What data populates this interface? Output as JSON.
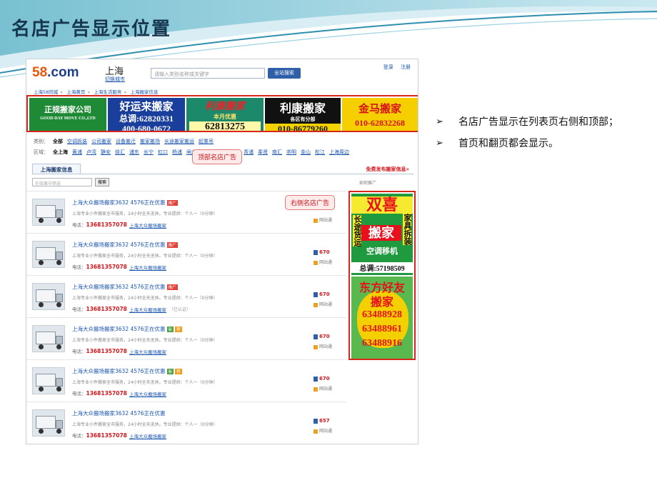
{
  "slide": {
    "title": "名店广告显示位置",
    "bullets": [
      "名店广告显示在列表页右侧和顶部；",
      "首页和翻页都会显示。"
    ]
  },
  "header": {
    "logo_prefix": "58",
    "logo_suffix": ".com",
    "city": "上海",
    "city_switch": "切换城市",
    "search_placeholder": "请输入类别名称或关键字",
    "search_button": "全站搜索",
    "login": "登录",
    "register": "注册"
  },
  "breadcrumb": [
    "上海58同城",
    "上海黄页",
    "上海生活服务",
    "上海搬家信息"
  ],
  "top_ads": [
    {
      "line1": "正规搬家公司",
      "line2": "GOOD DAY MOVE CO.,LTD"
    },
    {
      "line1": "好运来搬家",
      "line2": "总调:62820331",
      "line3": "400-680-0672"
    },
    {
      "line1": "利康搬家",
      "line2": "本月优惠",
      "line3": "62813275"
    },
    {
      "line1": "利康搬家",
      "line2": "各区有分部",
      "line3": "010-86779260"
    },
    {
      "line1": "金马搬家",
      "line2": "010-62832268"
    }
  ],
  "filters": {
    "category_label": "类别：",
    "category_selected": "全部",
    "category_items": [
      "空调拆装",
      "公司搬家",
      "设备搬迁",
      "搬家搬场",
      "长途搬家搬运",
      "起重吊"
    ],
    "district_label": "区域：",
    "district_selected": "全上海",
    "district_items": [
      "黄浦",
      "卢湾",
      "静安",
      "徐汇",
      "浦东",
      "长宁",
      "虹口",
      "杨浦",
      "闸北",
      "普陀",
      "宝山",
      "嘉定",
      "青浦",
      "奉贤",
      "南汇",
      "崇明",
      "金山",
      "松江",
      "上海周边"
    ]
  },
  "list_tab": "上海搬家信息",
  "free_post": "免费发布搬家信息»",
  "filter_placeholder": "在结果中筛选",
  "search_small": "搜索",
  "sort_label": "如何推广",
  "callouts": {
    "top": "顶部名店广告",
    "right": "右侧名店广告"
  },
  "listings": [
    {
      "title": "上海大众搬场搬家3632 4576正在优惠",
      "badges": [
        "推广"
      ],
      "desc": "上海专业小件搬家全市服务，24小时全天无休。专业提供：个人一（0分钟）",
      "phone_label": "电话：",
      "phone": "13681357078",
      "company": "上海大众搬场搬家",
      "tag": "",
      "price": "",
      "verify": "网站通"
    },
    {
      "title": "上海大众搬场搬家3632 4576正在优惠",
      "badges": [
        "推广"
      ],
      "desc": "上海专业小件搬家全市服务，24小时全天无休。专业提供：个人一（0分钟）",
      "phone_label": "电话：",
      "phone": "13681357078",
      "company": "上海大众搬场搬家",
      "tag": "",
      "price": "670",
      "verify": "网站通"
    },
    {
      "title": "上海大众搬场搬家3632 4576正在优惠",
      "badges": [
        "推广"
      ],
      "desc": "上海专业小件搬家全市服务，24小时全天无休。专业提供：个人一（0分钟）",
      "phone_label": "电话：",
      "phone": "13681357078",
      "company": "上海大众搬场搬家",
      "tag": "（已认证）",
      "price": "670",
      "verify": "网站通"
    },
    {
      "title": "上海大众搬场搬家3632 4576正在优惠",
      "badges": [
        "新",
        "荐"
      ],
      "desc": "上海专业小件搬家全市服务，24小时全天无休。专业提供：个人一（0分钟）",
      "phone_label": "电话：",
      "phone": "13681357078",
      "company": "上海大众搬场搬家",
      "tag": "",
      "price": "670",
      "verify": "网站通"
    },
    {
      "title": "上海大众搬场搬家3632 4576正在优惠",
      "badges": [
        "新",
        "荐"
      ],
      "desc": "上海专业小件搬家全市服务，24小时全天无休。专业提供：个人一（0分钟）",
      "phone_label": "电话：",
      "phone": "13681357078",
      "company": "上海大众搬场搬家",
      "tag": "",
      "price": "670",
      "verify": "网站通"
    },
    {
      "title": "上海大众搬场搬家3632 4576正在优惠",
      "badges": [],
      "desc": "上海专业小件搬家全市服务，24小时全天无休。专业提供：个人一（0分钟）",
      "phone_label": "电话：",
      "phone": "13681357078",
      "company": "上海大众搬场搬家",
      "tag": "",
      "price": "657",
      "verify": "网站通"
    }
  ],
  "side_ads": [
    {
      "name": "双喜",
      "name2": "搬家",
      "left_vertical": "长途货运",
      "right_vertical": "家具拆装",
      "service": "空调移机",
      "tel": "总调:57198509"
    },
    {
      "name": "东方好友",
      "name2": "搬家",
      "phones": [
        "63488928",
        "63488961",
        "63488916"
      ]
    }
  ],
  "colors": {
    "title": "#17374f",
    "accent_red": "#d9261c",
    "link_blue": "#1a55b0",
    "callout_fill": "#fdeaea"
  }
}
